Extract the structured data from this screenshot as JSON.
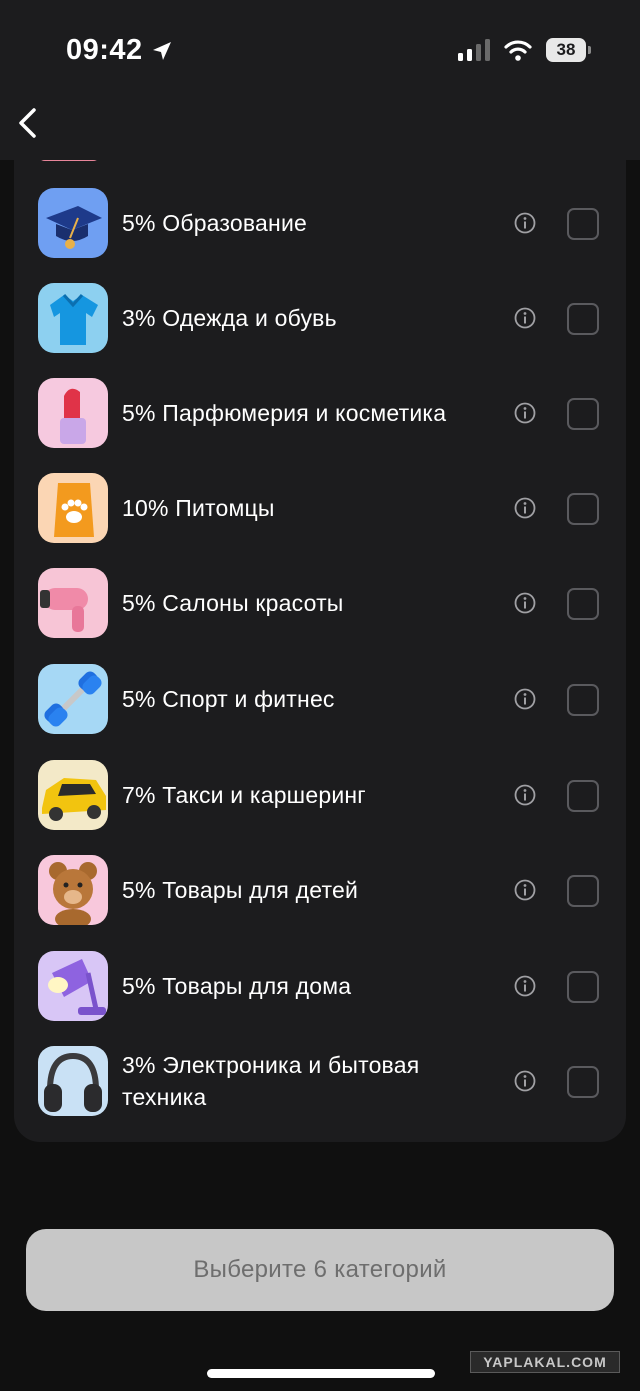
{
  "status_bar": {
    "time": "09:42",
    "battery": "38"
  },
  "nav": {
    "back_icon": "chevron-left-icon"
  },
  "categories": [
    {
      "label": "5% Образование",
      "icon": "graduation-cap-icon"
    },
    {
      "label": "3% Одежда и обувь",
      "icon": "polo-shirt-icon"
    },
    {
      "label": "5% Парфюмерия и косметика",
      "icon": "lipstick-icon"
    },
    {
      "label": "10% Питомцы",
      "icon": "pet-food-bag-icon"
    },
    {
      "label": "5% Салоны красоты",
      "icon": "hair-dryer-icon"
    },
    {
      "label": "5% Спорт и фитнес",
      "icon": "dumbbell-icon"
    },
    {
      "label": "7% Такси и каршеринг",
      "icon": "taxi-car-icon"
    },
    {
      "label": "5% Товары для детей",
      "icon": "teddy-bear-icon"
    },
    {
      "label": "5% Товары для дома",
      "icon": "desk-lamp-icon"
    },
    {
      "label": "3% Электроника и бытовая техника",
      "icon": "headphones-icon"
    }
  ],
  "cta": {
    "label": "Выберите 6 категорий"
  },
  "watermark": "YAPLAKAL.COM"
}
